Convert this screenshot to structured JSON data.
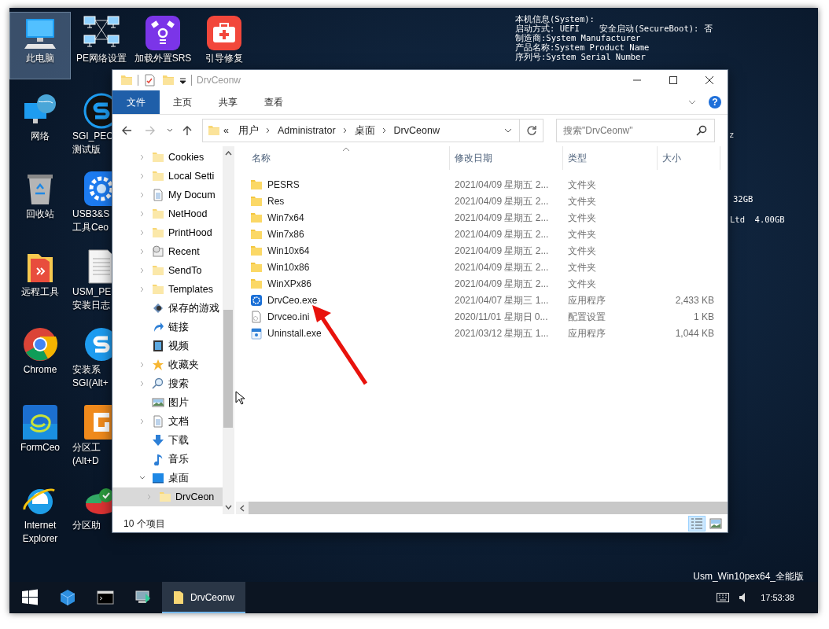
{
  "desktop": {
    "icon_columns": [
      [
        {
          "lines": [
            "此电脑"
          ],
          "selected": true
        },
        {
          "lines": [
            "网络"
          ],
          "selected": false
        },
        {
          "lines": [
            "回收站"
          ],
          "selected": false
        },
        {
          "lines": [
            "远程工具"
          ],
          "selected": false
        },
        {
          "lines": [
            "Chrome"
          ],
          "selected": false
        },
        {
          "lines": [
            "FormCeo"
          ],
          "selected": false
        },
        {
          "lines": [
            "Internet",
            "Explorer"
          ],
          "selected": false
        }
      ],
      [
        {
          "lines": [
            "PE网络设置"
          ],
          "selected": false
        },
        {
          "lines": [
            "SGI_PEC",
            "测试版"
          ],
          "selected": false
        },
        {
          "lines": [
            "USB3&S",
            "工具Ceo"
          ],
          "selected": false
        },
        {
          "lines": [
            "USM_PE",
            "安装日志"
          ],
          "selected": false
        },
        {
          "lines": [
            "安装系",
            "SGI(Alt+"
          ],
          "selected": false
        },
        {
          "lines": [
            "分区工",
            "(Alt+D"
          ],
          "selected": false
        },
        {
          "lines": [
            "分区助"
          ],
          "selected": false
        }
      ],
      [
        {
          "lines": [
            "加载外置SRS"
          ],
          "selected": false
        }
      ],
      [
        {
          "lines": [
            "引导修复"
          ],
          "selected": false
        }
      ]
    ],
    "system_info": [
      "本机信息(System):",
      "启动方式: UEFI    安全启动(SecureBoot): 否",
      "制造商:System Manufacturer",
      "产品名称:System Product Name",
      "序列号:System Serial Number"
    ],
    "system_info_partial": [
      "z",
      "32GB",
      "Ltd  4.00GB"
    ],
    "edition": "Usm_Win10pex64_全能版"
  },
  "explorer": {
    "title": "DrvCeonw",
    "ribbon_tabs": [
      {
        "label": "文件",
        "kind": "file"
      },
      {
        "label": "主页",
        "kind": "tab"
      },
      {
        "label": "共享",
        "kind": "tab"
      },
      {
        "label": "查看",
        "kind": "tab"
      }
    ],
    "address": {
      "overflow": "«",
      "crumbs": [
        "用户",
        "Administrator",
        "桌面",
        "DrvCeonw"
      ]
    },
    "search": {
      "placeholder": "搜索\"DrvCeonw\""
    },
    "nav": [
      {
        "label": "Cookies",
        "expandable": true,
        "expanded": false,
        "selected": false
      },
      {
        "label": "Local Setti",
        "expandable": true,
        "expanded": false,
        "selected": false
      },
      {
        "label": "My Docum",
        "expandable": true,
        "expanded": false,
        "selected": false
      },
      {
        "label": "NetHood",
        "expandable": true,
        "expanded": false,
        "selected": false
      },
      {
        "label": "PrintHood",
        "expandable": true,
        "expanded": false,
        "selected": false
      },
      {
        "label": "Recent",
        "expandable": true,
        "expanded": false,
        "selected": false
      },
      {
        "label": "SendTo",
        "expandable": true,
        "expanded": false,
        "selected": false
      },
      {
        "label": "Templates",
        "expandable": true,
        "expanded": false,
        "selected": false
      },
      {
        "label": "保存的游戏",
        "expandable": false,
        "expanded": false,
        "selected": false
      },
      {
        "label": "链接",
        "expandable": false,
        "expanded": false,
        "selected": false
      },
      {
        "label": "视频",
        "expandable": false,
        "expanded": false,
        "selected": false
      },
      {
        "label": "收藏夹",
        "expandable": true,
        "expanded": false,
        "selected": false
      },
      {
        "label": "搜索",
        "expandable": true,
        "expanded": false,
        "selected": false
      },
      {
        "label": "图片",
        "expandable": false,
        "expanded": false,
        "selected": false
      },
      {
        "label": "文档",
        "expandable": true,
        "expanded": false,
        "selected": false
      },
      {
        "label": "下载",
        "expandable": false,
        "expanded": false,
        "selected": false
      },
      {
        "label": "音乐",
        "expandable": false,
        "expanded": false,
        "selected": false
      },
      {
        "label": "桌面",
        "expandable": true,
        "expanded": true,
        "selected": false,
        "children": [
          {
            "label": "DrvCeon",
            "expandable": true,
            "expanded": false,
            "selected": true
          }
        ]
      }
    ],
    "columns": [
      {
        "label": "名称",
        "sorted": true
      },
      {
        "label": "修改日期",
        "sorted": false
      },
      {
        "label": "类型",
        "sorted": false
      },
      {
        "label": "大小",
        "sorted": false
      }
    ],
    "rows": [
      {
        "kind": "folder",
        "name": "PESRS",
        "date": "2021/04/09 星期五 2...",
        "type": "文件夹"
      },
      {
        "kind": "folder",
        "name": "Res",
        "date": "2021/04/09 星期五 2...",
        "type": "文件夹"
      },
      {
        "kind": "folder",
        "name": "Win7x64",
        "date": "2021/04/09 星期五 2...",
        "type": "文件夹"
      },
      {
        "kind": "folder",
        "name": "Win7x86",
        "date": "2021/04/09 星期五 2...",
        "type": "文件夹"
      },
      {
        "kind": "folder",
        "name": "Win10x64",
        "date": "2021/04/09 星期五 2...",
        "type": "文件夹"
      },
      {
        "kind": "folder",
        "name": "Win10x86",
        "date": "2021/04/09 星期五 2...",
        "type": "文件夹"
      },
      {
        "kind": "folder",
        "name": "WinXPx86",
        "date": "2021/04/09 星期五 2...",
        "type": "文件夹"
      },
      {
        "kind": "app",
        "name": "DrvCeo.exe",
        "date": "2021/04/07 星期三 1...",
        "type": "应用程序",
        "size": "2,433 KB"
      },
      {
        "kind": "config",
        "name": "Drvceo.ini",
        "date": "2020/11/01 星期日 0...",
        "type": "配置设置",
        "size": "1 KB"
      },
      {
        "kind": "installer",
        "name": "Uninstall.exe",
        "date": "2021/03/12 星期五 1...",
        "type": "应用程序",
        "size": "1,044 KB"
      }
    ],
    "status": "10 个项目",
    "help": "?",
    "views": [
      {
        "kind": "details",
        "selected": true
      },
      {
        "kind": "thumbnails",
        "selected": false
      }
    ]
  },
  "taskbar": {
    "apps": [
      {
        "label": "DrvCeonw",
        "active": true
      }
    ],
    "clock": "17:53:38"
  }
}
